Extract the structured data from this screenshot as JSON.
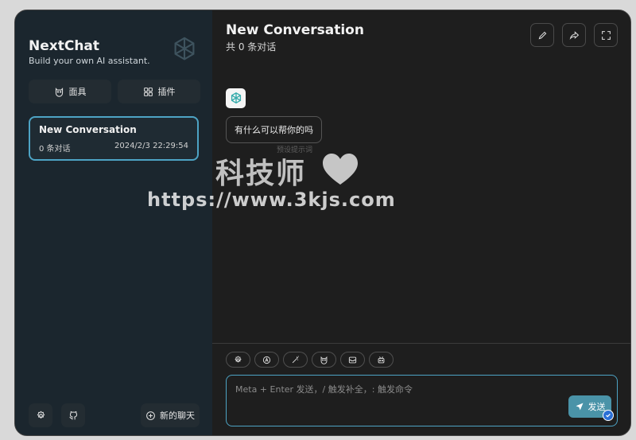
{
  "sidebar": {
    "title": "NextChat",
    "subtitle": "Build your own AI assistant.",
    "mask_label": "面具",
    "plugin_label": "插件",
    "sessions": [
      {
        "title": "New Conversation",
        "count": "0 条对话",
        "time": "2024/2/3 22:29:54"
      }
    ],
    "new_chat_label": "新的聊天"
  },
  "chat": {
    "title": "New Conversation",
    "subtitle": "共 0 条对话",
    "greeting": "有什么可以帮你的吗",
    "greeting_hint": "预设提示词"
  },
  "watermark": {
    "text_cn": "科技师",
    "url": "https://www.3kjs.com"
  },
  "input": {
    "placeholder": "Meta + Enter 发送，/ 触发补全，: 触发命令"
  },
  "send_label": "发送",
  "colors": {
    "accent": "#4da3c4",
    "send": "#4a93a8",
    "sidebar_bg": "#1b262e",
    "main_bg": "#1e1e1e"
  },
  "icons": {
    "toolbar": [
      "settings-icon",
      "auto-theme-icon",
      "prompt-wand-icon",
      "mask-icon",
      "clear-context-icon",
      "robot-icon"
    ],
    "header": [
      "edit-icon",
      "share-icon",
      "fullscreen-icon"
    ]
  }
}
